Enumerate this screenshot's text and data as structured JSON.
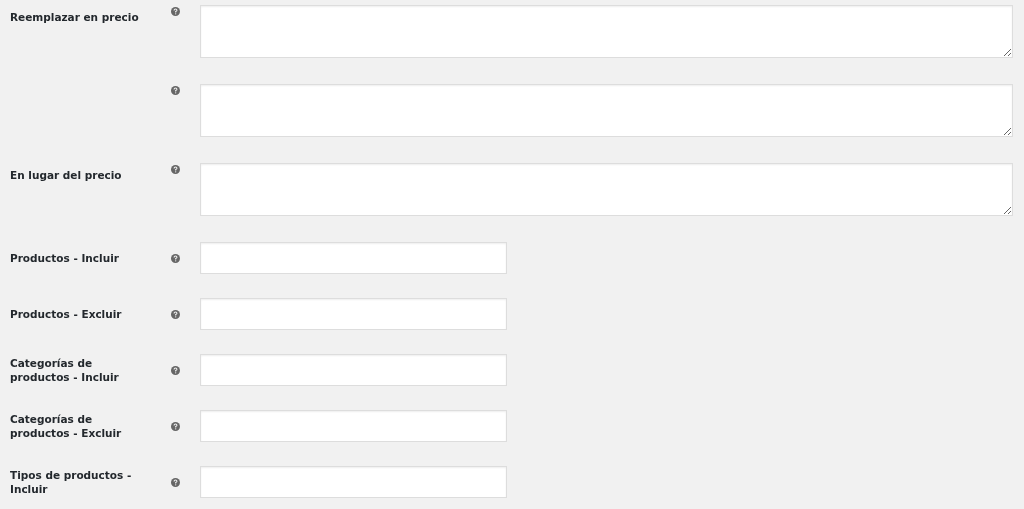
{
  "fields": [
    {
      "kind": "textarea",
      "label": "Reemplazar en precio"
    },
    {
      "kind": "textarea"
    },
    {
      "kind": "textarea",
      "label": "En lugar del precio"
    },
    {
      "kind": "text",
      "label": "Productos - Incluir"
    },
    {
      "kind": "text",
      "label": "Productos - Excluir"
    },
    {
      "kind": "text",
      "label": "Categorías de productos - Incluir"
    },
    {
      "kind": "text",
      "label": "Categorías de productos - Excluir"
    },
    {
      "kind": "text",
      "label": "Tipos de productos - Incluir"
    }
  ]
}
